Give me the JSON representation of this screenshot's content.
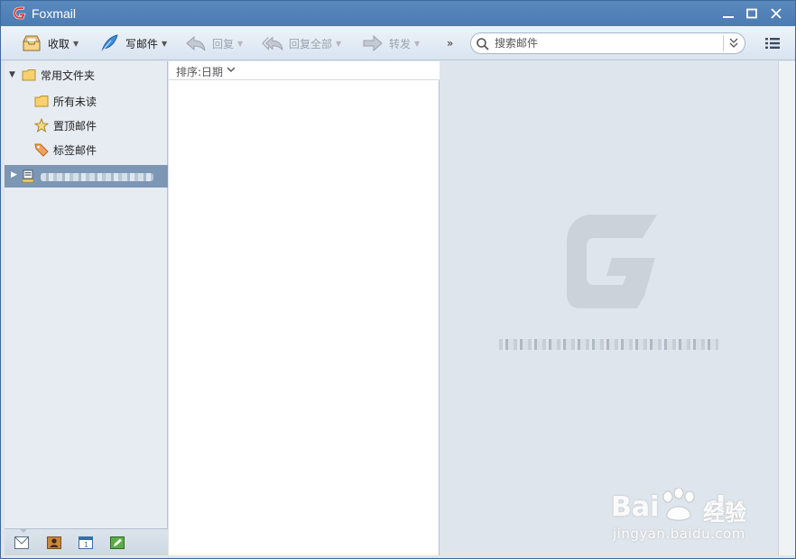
{
  "window": {
    "title": "Foxmail"
  },
  "toolbar": {
    "receive": "收取",
    "compose": "写邮件",
    "reply": "回复",
    "reply_all": "回复全部",
    "forward": "转发",
    "more": "»",
    "search_placeholder": "搜索邮件"
  },
  "sidebar": {
    "group_label": "常用文件夹",
    "items": [
      {
        "label": "所有未读",
        "icon": "folder-icon"
      },
      {
        "label": "置顶邮件",
        "icon": "star-icon"
      },
      {
        "label": "标签邮件",
        "icon": "tag-icon"
      }
    ]
  },
  "list": {
    "sort_label": "排序:日期"
  },
  "watermark": {
    "brand_left": "Bai",
    "brand_right": "du",
    "brand_jy": "经验",
    "url": "jingyan.baidu.com"
  },
  "colors": {
    "titlebar": "#4a7bb3",
    "selected_account": "#7c97b5",
    "app_logo": "#d9272e"
  }
}
